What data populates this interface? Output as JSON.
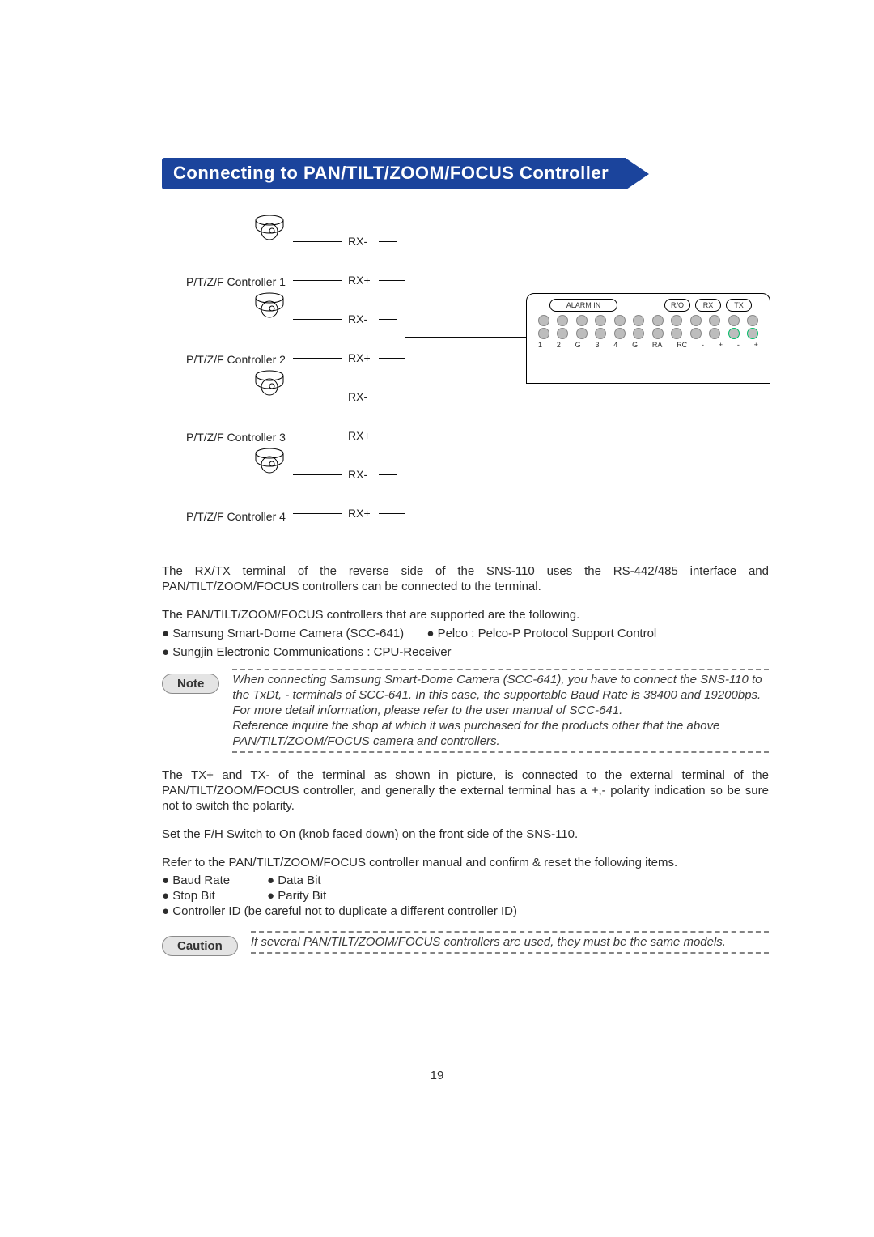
{
  "ribbon": {
    "title": "Connecting to PAN/TILT/ZOOM/FOCUS Controller"
  },
  "diagram": {
    "controllers": [
      {
        "label": "P/T/Z/F Controller 1",
        "rx_minus": "RX-",
        "rx_plus": "RX+"
      },
      {
        "label": "P/T/Z/F Controller 2",
        "rx_minus": "RX-",
        "rx_plus": "RX+"
      },
      {
        "label": "P/T/Z/F Controller 3",
        "rx_minus": "RX-",
        "rx_plus": "RX+"
      },
      {
        "label": "P/T/Z/F Controller 4",
        "rx_minus": "RX-",
        "rx_plus": "RX+"
      }
    ],
    "connector": {
      "alarm": "ALARM IN",
      "pills": [
        "R/O",
        "RX",
        "TX"
      ],
      "legend": [
        "1",
        "2",
        "G",
        "3",
        "4",
        "G",
        "RA",
        "RC",
        "-",
        "+",
        "-",
        "+"
      ]
    }
  },
  "text": {
    "p1": "The RX/TX terminal of the reverse side of the SNS-110 uses the RS-442/485 interface and PAN/TILT/ZOOM/FOCUS  controllers can be connected to the terminal.",
    "p2": "The PAN/TILT/ZOOM/FOCUS controllers that are supported are the following.",
    "support_b1": "Samsung Smart-Dome Camera (SCC-641)",
    "support_b2": "Pelco : Pelco-P Protocol Support Control",
    "support_b3": "Sungjin Electronic Communications : CPU-Receiver",
    "note_label": "Note",
    "note": "When connecting Samsung Smart-Dome Camera (SCC-641), you have to connect the SNS-110 to the TxDt, -  terminals of SCC-641.  In this case, the supportable Baud Rate is 38400 and 19200bps.  For more detail information, please refer to the user manual of SCC-641.",
    "note_line2": "Reference inquire the shop at which it was purchased for the products other that the above PAN/TILT/ZOOM/FOCUS camera and controllers.",
    "p3": "The TX+ and TX- of the terminal as shown in picture, is connected to the external terminal of the PAN/TILT/ZOOM/FOCUS controller, and generally the external terminal has a +,- polarity indication so be sure not to switch the polarity.",
    "p4": "Set the F/H Switch  to On (knob faced down) on the front side of the SNS-110.",
    "p5": "Refer to the PAN/TILT/ZOOM/FOCUS controller manual and confirm & reset the following items.",
    "conf": {
      "a1": "Baud Rate",
      "a2": "Data Bit",
      "b1": "Stop Bit",
      "b2": "Parity Bit",
      "c1": "Controller ID (be careful not to duplicate a different controller ID)"
    },
    "caution_label": "Caution",
    "caution": "If several PAN/TILT/ZOOM/FOCUS controllers are used, they must be the same models."
  },
  "page_number": "19"
}
